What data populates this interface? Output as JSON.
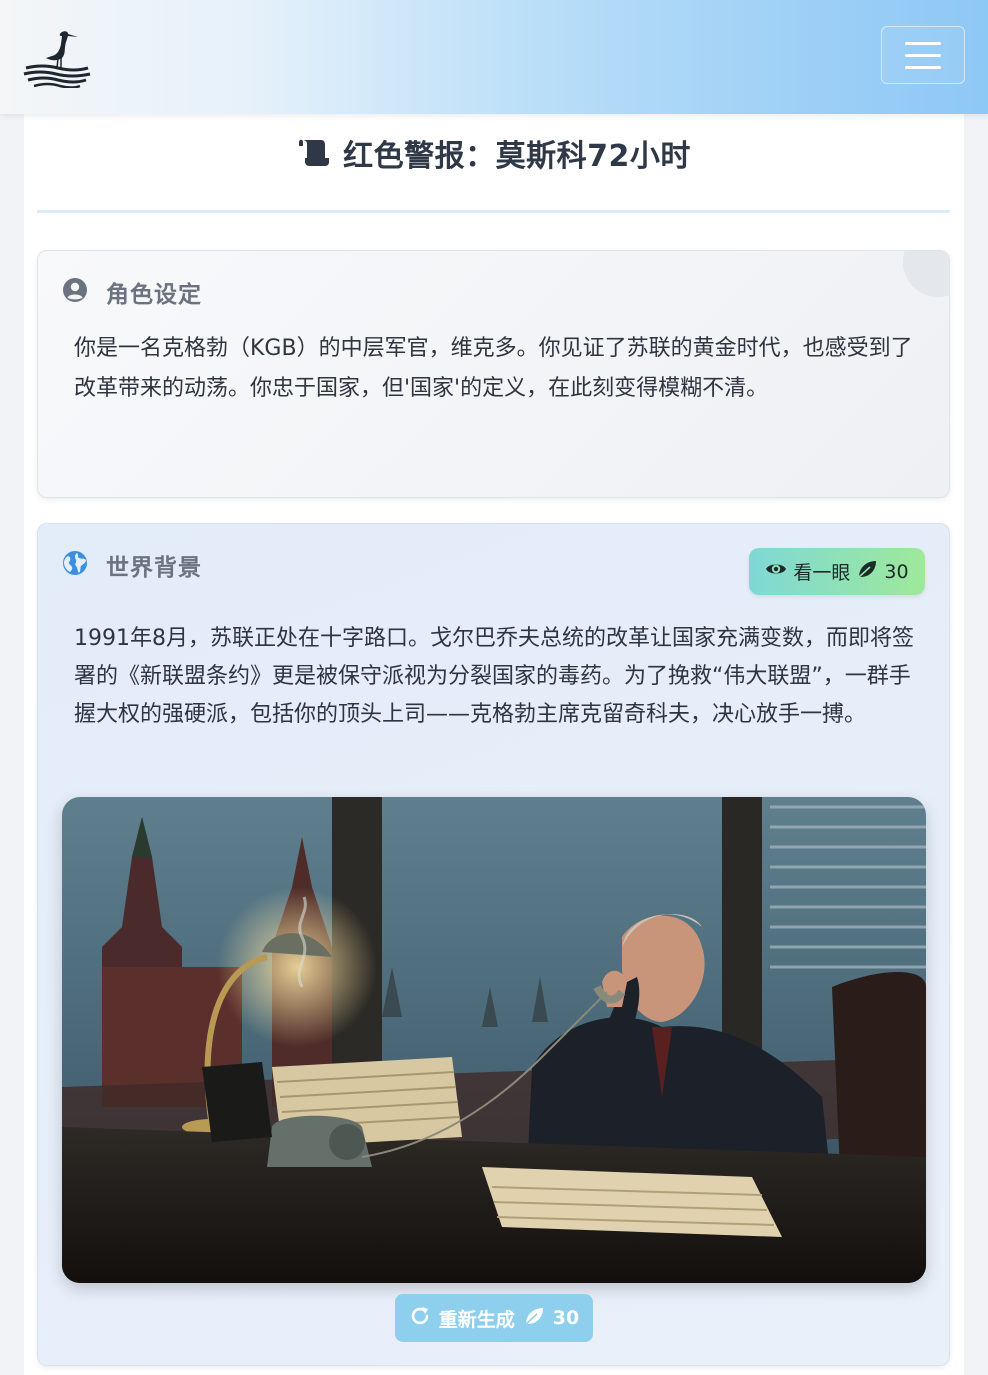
{
  "header": {
    "logo_name": "heron-logo",
    "menu_icon": "hamburger-icon"
  },
  "page": {
    "title": "红色警报：莫斯科72小时",
    "title_icon": "scroll-icon"
  },
  "role_card": {
    "icon": "user-circle-icon",
    "heading": "角色设定",
    "text": "你是一名克格勃（KGB）的中层军官，维克多。你见证了苏联的黄金时代，也感受到了改革带来的动荡。你忠于国家，但'国家'的定义，在此刻变得模糊不清。"
  },
  "world_card": {
    "icon": "globe-icon",
    "heading": "世界背景",
    "peek_button": {
      "icon": "eye-icon",
      "label": "看一眼",
      "cost_icon": "leaf-icon",
      "cost": "30"
    },
    "text": "1991年8月，苏联正处在十字路口。戈尔巴乔夫总统的改革让国家充满变数，而即将签署的《新联盟条约》更是被保守派视为分裂国家的毒药。为了挽救“伟大联盟”，一群手握大权的强硬派，包括你的顶头上司——克格勃主席克留奇科夫，决心放手一搏。",
    "image_name": "kgb-officer-office-scene",
    "regen_button": {
      "icon": "refresh-icon",
      "label": "重新生成",
      "cost_icon": "leaf-icon",
      "cost": "30"
    }
  },
  "colors": {
    "accent_blue": "#8fcfee",
    "peek_gradient_start": "#7fd8d6",
    "peek_gradient_end": "#9ee99a",
    "globe_blue": "#3b8fe0"
  }
}
